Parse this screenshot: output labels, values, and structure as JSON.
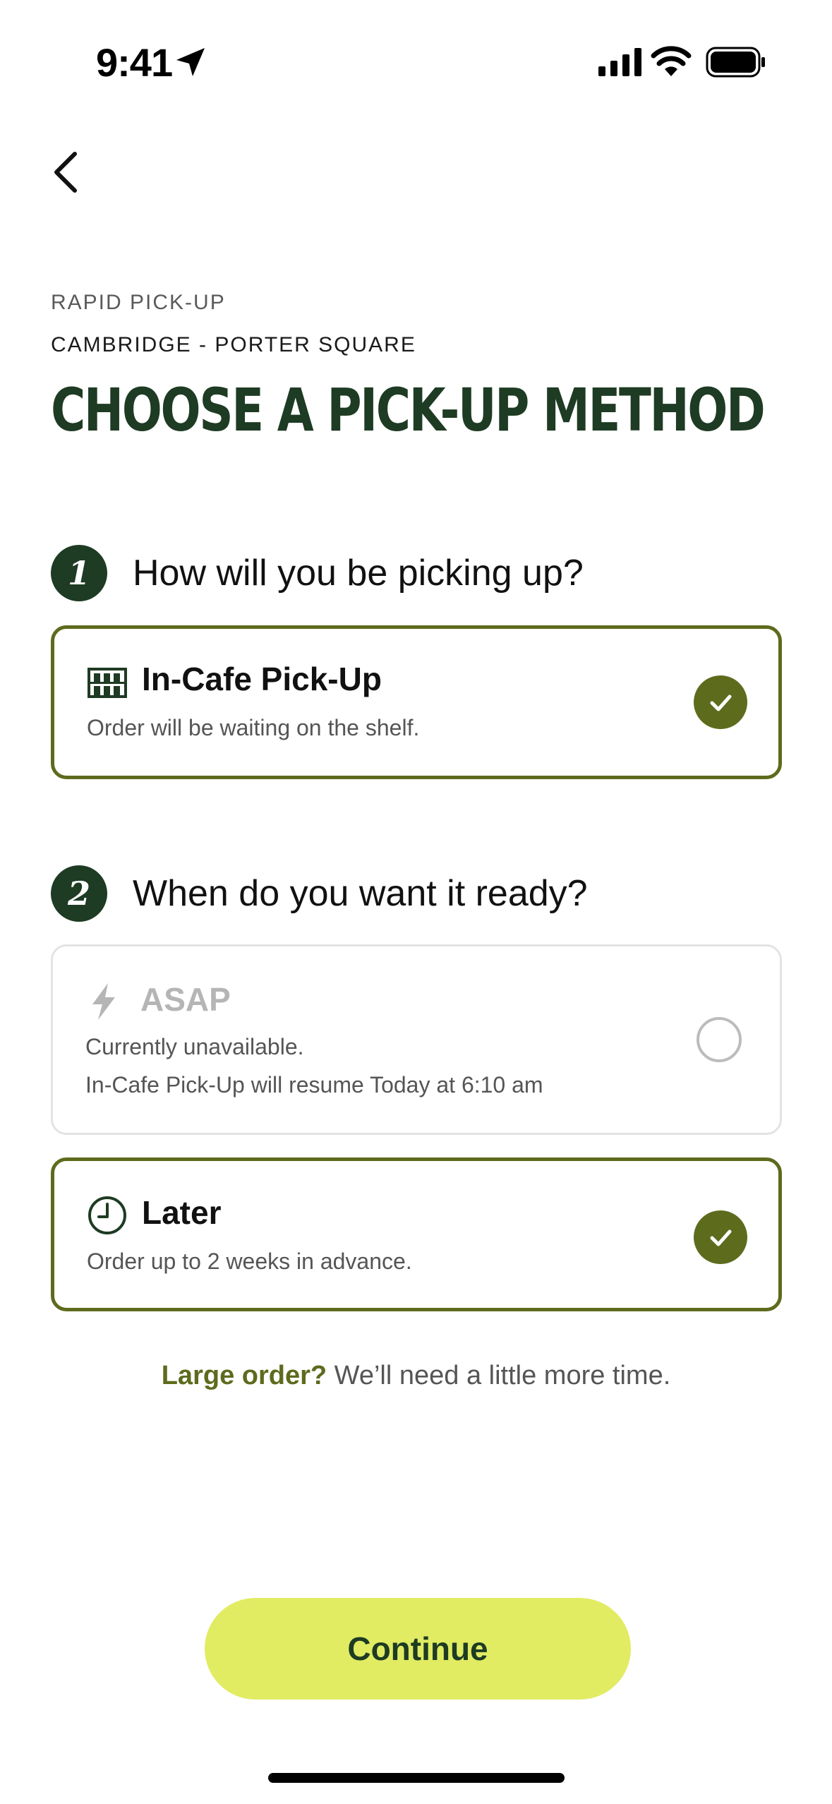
{
  "status_bar": {
    "time": "9:41"
  },
  "header": {
    "eyebrow": "RAPID PICK-UP",
    "store": "CAMBRIDGE - PORTER SQUARE",
    "title": "CHOOSE A PICK-UP METHOD"
  },
  "step1": {
    "number": "1",
    "question": "How will you be picking up?",
    "options": [
      {
        "title": "In-Cafe Pick-Up",
        "subtitle": "Order will be waiting on the shelf.",
        "selected": true,
        "icon": "shelf-icon"
      }
    ]
  },
  "step2": {
    "number": "2",
    "question": "When do you want it ready?",
    "options": [
      {
        "title": "ASAP",
        "subtitle": "Currently unavailable.",
        "detail": "In-Cafe Pick-Up will resume Today at 6:10 am",
        "selected": false,
        "disabled": true,
        "icon": "lightning-icon"
      },
      {
        "title": "Later",
        "subtitle": "Order up to 2 weeks in advance.",
        "selected": true,
        "icon": "clock-icon"
      }
    ]
  },
  "note": {
    "strong": "Large order?",
    "text": "We’ll need a little more time."
  },
  "continue_label": "Continue",
  "colors": {
    "brand_dark": "#1e3b23",
    "accent_olive": "#5d6b1d",
    "cta_lime": "#e1ec63"
  }
}
